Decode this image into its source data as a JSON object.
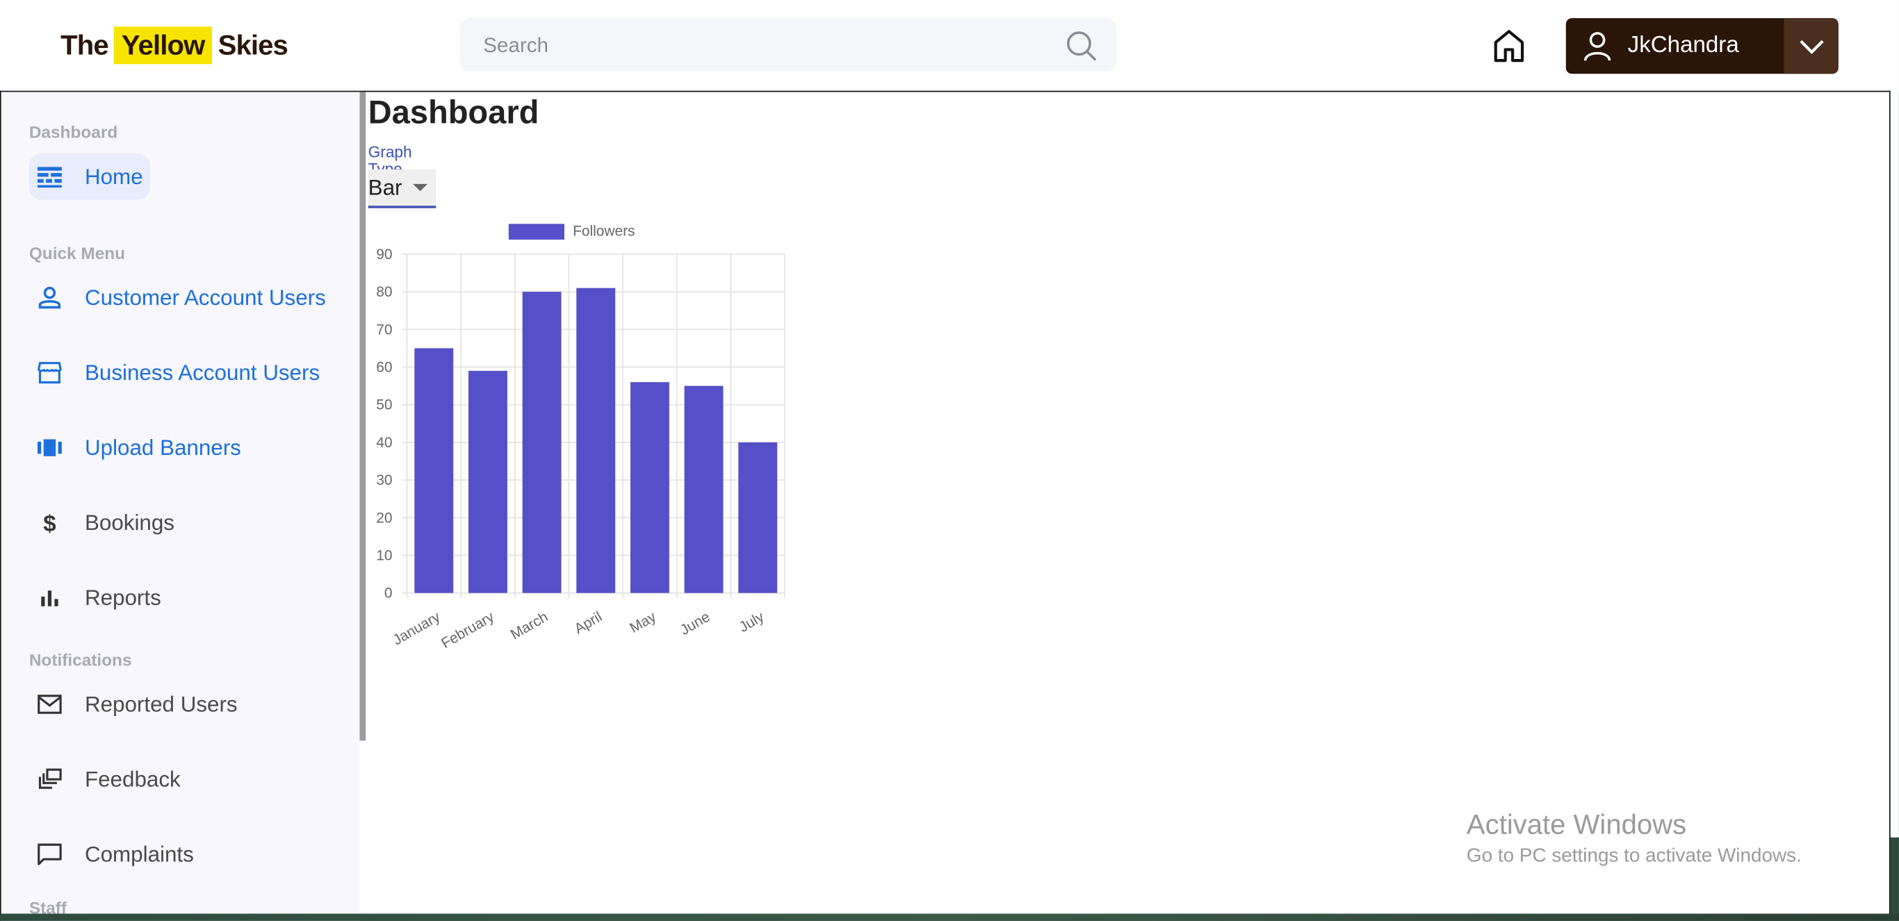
{
  "header": {
    "logo": {
      "part1": "The",
      "part2": "Yellow",
      "part3": "Skies"
    },
    "search_placeholder": "Search",
    "user_name": "JkChandra"
  },
  "sidebar": {
    "sections": [
      {
        "title": "Dashboard",
        "items": [
          {
            "label": "Home",
            "icon": "dashboard-icon",
            "active": true
          }
        ]
      },
      {
        "title": "Quick Menu",
        "items": [
          {
            "label": "Customer Account Users",
            "icon": "person-icon"
          },
          {
            "label": "Business Account Users",
            "icon": "store-icon"
          },
          {
            "label": "Upload Banners",
            "icon": "carousel-icon"
          },
          {
            "label": "Bookings",
            "icon": "dollar-icon"
          },
          {
            "label": "Reports",
            "icon": "bar-chart-icon"
          }
        ]
      },
      {
        "title": "Notifications",
        "items": [
          {
            "label": "Reported Users",
            "icon": "mail-icon"
          },
          {
            "label": "Feedback",
            "icon": "dynamic-feed-icon"
          },
          {
            "label": "Complaints",
            "icon": "chat-bubble-icon"
          }
        ]
      },
      {
        "title": "Staff",
        "items": []
      }
    ]
  },
  "main": {
    "title": "Dashboard",
    "graph_type_label": "Graph Type",
    "graph_type_value": "Bar"
  },
  "chart_data": {
    "type": "bar",
    "categories": [
      "January",
      "February",
      "March",
      "April",
      "May",
      "June",
      "July"
    ],
    "series": [
      {
        "name": "Followers",
        "values": [
          65,
          59,
          80,
          81,
          56,
          55,
          40
        ],
        "color": "#5550c8"
      }
    ],
    "ylim": [
      0,
      90
    ],
    "yticks": [
      0,
      10,
      20,
      30,
      40,
      50,
      60,
      70,
      80,
      90
    ],
    "legend": "top",
    "grid": true
  },
  "watermark": {
    "line1": "Activate Windows",
    "line2": "Go to PC settings to activate Windows."
  }
}
